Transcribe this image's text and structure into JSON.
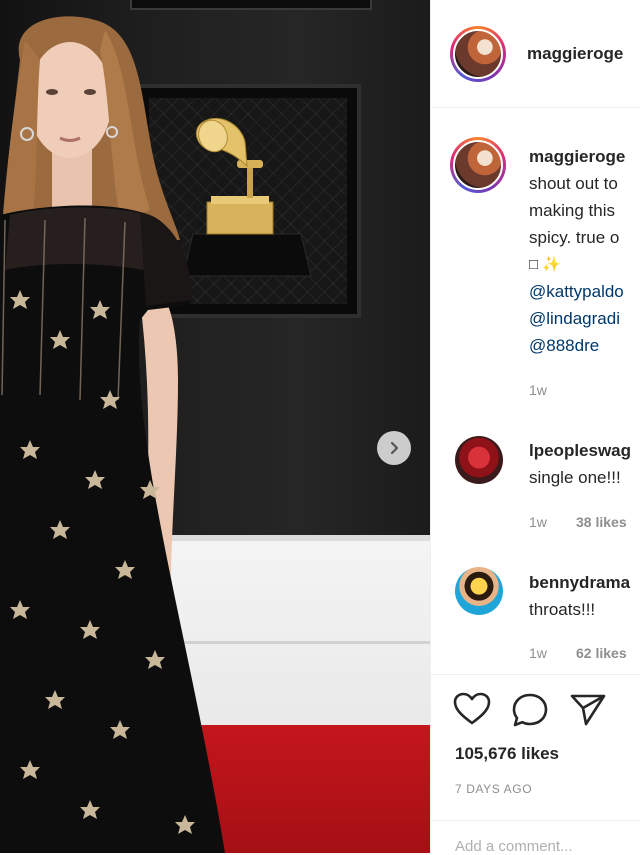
{
  "post": {
    "username": "maggieroge",
    "caption": {
      "username": "maggieroge",
      "lines": [
        "shout out to",
        "making this",
        "spicy. true o",
        "□ ✨"
      ],
      "mentions": [
        "@kattypaldo",
        "@lindagradi",
        "@888dre"
      ],
      "time": "1w"
    },
    "comments": [
      {
        "username": "lpeopleswag",
        "text": "single one!!!",
        "time": "1w",
        "likes": "38 likes"
      },
      {
        "username": "bennydrama",
        "text": "throats!!!",
        "time": "1w",
        "likes": "62 likes"
      }
    ],
    "likes": "105,676 likes",
    "date": "7 DAYS AGO",
    "add_comment": "Add a comment..."
  },
  "colors": {
    "accent_link": "#00376b",
    "muted": "#8e8e8e",
    "carpet": "#c4161c"
  },
  "icons": [
    "heart-icon",
    "comment-icon",
    "share-icon",
    "chevron-right-icon"
  ]
}
